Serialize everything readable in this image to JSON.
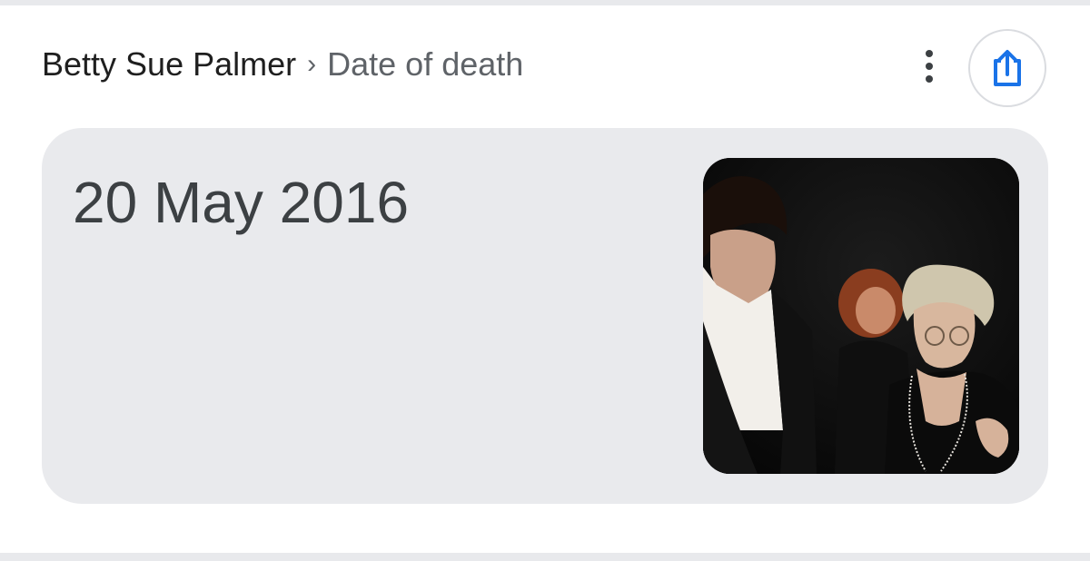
{
  "breadcrumb": {
    "entity": "Betty Sue Palmer",
    "separator": "›",
    "attribute": "Date of death"
  },
  "actions": {
    "more_icon": "more-vert-icon",
    "share_icon": "share-icon"
  },
  "answer": {
    "value": "20 May 2016"
  },
  "colors": {
    "card_background": "#e9eaed",
    "accent_blue": "#1a73e8",
    "text_primary": "#1f1f1f",
    "text_secondary": "#5f6368"
  }
}
